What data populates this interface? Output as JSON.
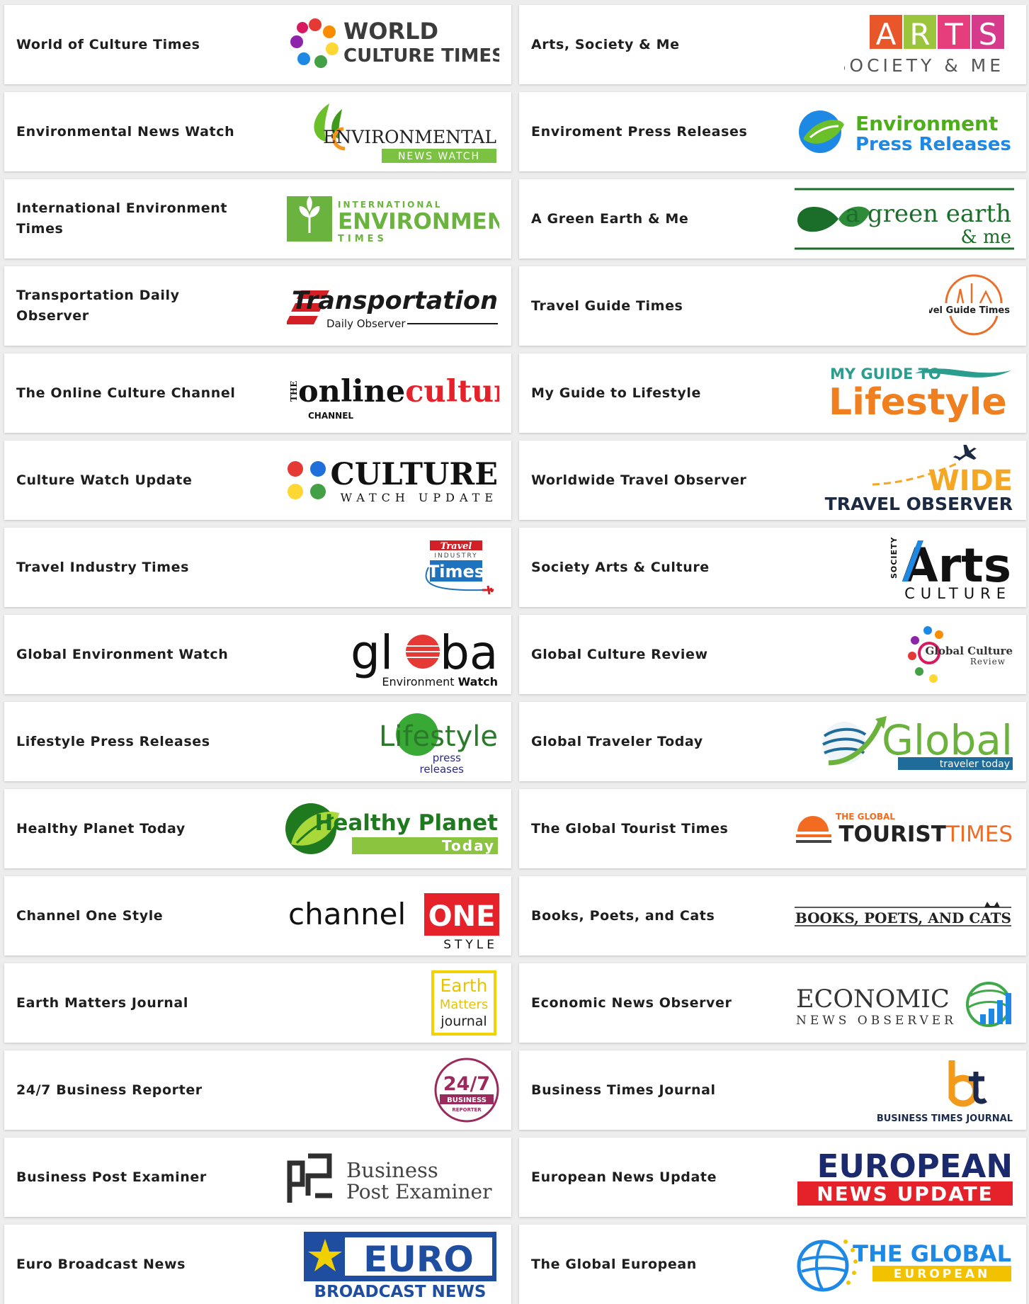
{
  "cards": [
    {
      "name": "World of Culture Times",
      "logo": {
        "icon": "flower-people-icon",
        "lines": [
          "WORLD",
          "CULTURE TIMES"
        ]
      }
    },
    {
      "name": "Arts, Society & Me",
      "logo": {
        "letters": [
          "A",
          "R",
          "T",
          "S"
        ],
        "sub": "SOCIETY & ME",
        "colors": [
          "#e8562a",
          "#9bc53d",
          "#e63d7c",
          "#d63a8a"
        ]
      }
    },
    {
      "name": "Environmental News Watch",
      "logo": {
        "icon": "leaf-icon",
        "main": "ENVIRONMENTAL",
        "sub": "NEWS WATCH"
      }
    },
    {
      "name": "Enviroment Press Releases",
      "logo": {
        "icon": "globe-leaf-icon",
        "line1": "Environment",
        "line2": "Press Releases"
      }
    },
    {
      "name": "International Environment Times",
      "logo": {
        "icon": "sprout-icon",
        "top": "INTERNATIONAL",
        "main": "ENVIRONMENT",
        "bottom": "TIMES"
      }
    },
    {
      "name": "A Green Earth & Me",
      "logo": {
        "icon": "green-leaf-icon",
        "main": "a green earth",
        "sub": "& me"
      }
    },
    {
      "name": "Transportation Daily Observer",
      "logo": {
        "icon": "speed-stripes-icon",
        "main": "Transportation",
        "sub": "Daily Observer"
      }
    },
    {
      "name": "Travel Guide Times",
      "logo": {
        "icon": "landmarks-circle-icon",
        "main": "Travel Guide Times"
      }
    },
    {
      "name": "The Online Culture Channel",
      "logo": {
        "the": "THE",
        "part1": "online",
        "part2": "culture",
        "sub": "CHANNEL"
      }
    },
    {
      "name": "My Guide to Lifestyle",
      "logo": {
        "icon": "swoosh-icon",
        "top": "MY GUIDE TO",
        "main": "Lifestyle"
      }
    },
    {
      "name": "Culture Watch Update",
      "logo": {
        "icon": "four-dots-icon",
        "main": "CULTURE",
        "sub": "WATCH UPDATE"
      }
    },
    {
      "name": "Worldwide Travel Observer",
      "logo": {
        "icon": "airplane-icon",
        "main": "WIDE",
        "sub": "TRAVEL OBSERVER"
      }
    },
    {
      "name": "Travel Industry Times",
      "logo": {
        "icon": "airplane-icon",
        "top": "Travel",
        "mid": "INDUSTRY",
        "main": "Times"
      }
    },
    {
      "name": "Society Arts & Culture",
      "logo": {
        "side": "SOCIETY",
        "main": "Arts",
        "sub": "CULTURE"
      }
    },
    {
      "name": "Global Environment Watch",
      "logo": {
        "main1": "gl",
        "main2": "bal",
        "sub1": "Environment ",
        "sub2": "Watch"
      }
    },
    {
      "name": "Global Culture Review",
      "logo": {
        "icon": "colorful-people-icon",
        "main": "Global Culture",
        "sub": "Review"
      }
    },
    {
      "name": "Lifestyle Press Releases",
      "logo": {
        "icon": "green-circle-icon",
        "main": "Lifestyle",
        "sub1": "press",
        "sub2": "releases"
      }
    },
    {
      "name": "Global Traveler Today",
      "logo": {
        "icon": "globe-arrow-icon",
        "main": "Global",
        "sub": "traveler today"
      }
    },
    {
      "name": "Healthy Planet Today",
      "logo": {
        "icon": "leaf-globe-icon",
        "main": "Healthy Planet",
        "sub": "Today"
      }
    },
    {
      "name": "The Global Tourist Times",
      "logo": {
        "icon": "sunrise-icon",
        "top": "THE GLOBAL",
        "main1": "TOURIST",
        "main2": "TIMES"
      }
    },
    {
      "name": "Channel One Style",
      "logo": {
        "main": "channel",
        "box": "ONE",
        "sub": "STYLE"
      }
    },
    {
      "name": "Books, Poets, and Cats",
      "logo": {
        "icon": "cat-icon",
        "main": "BOOKS, POETS, AND CATS"
      }
    },
    {
      "name": "Earth Matters Journal",
      "logo": {
        "l1": "Earth",
        "l2": "Matters",
        "l3": "journal"
      }
    },
    {
      "name": "Economic News Observer",
      "logo": {
        "icon": "globe-chart-icon",
        "main": "ECONOMIC",
        "sub": "NEWS OBSERVER"
      }
    },
    {
      "name": "24/7 Business Reporter",
      "logo": {
        "main": "24/7",
        "sub": "BUSINESS",
        "tiny": "REPORTER"
      }
    },
    {
      "name": "Business Times Journal",
      "logo": {
        "icon": "bt-monogram-icon",
        "main": "BUSINESS TIMES JOURNAL"
      }
    },
    {
      "name": "Business Post Examiner",
      "logo": {
        "icon": "bp-monogram-icon",
        "l1": "Business",
        "l2": "Post Examiner"
      }
    },
    {
      "name": "European News Update",
      "logo": {
        "main": "EUROPEAN",
        "sub": "NEWS UPDATE"
      }
    },
    {
      "name": "Euro Broadcast News",
      "logo": {
        "icon": "star-icon",
        "main": "EURO",
        "sub": "BROADCAST NEWS"
      }
    },
    {
      "name": "The Global European",
      "logo": {
        "icon": "globe-stars-icon",
        "main": "THE GLOBAL",
        "sub": "EUROPEAN"
      }
    }
  ]
}
